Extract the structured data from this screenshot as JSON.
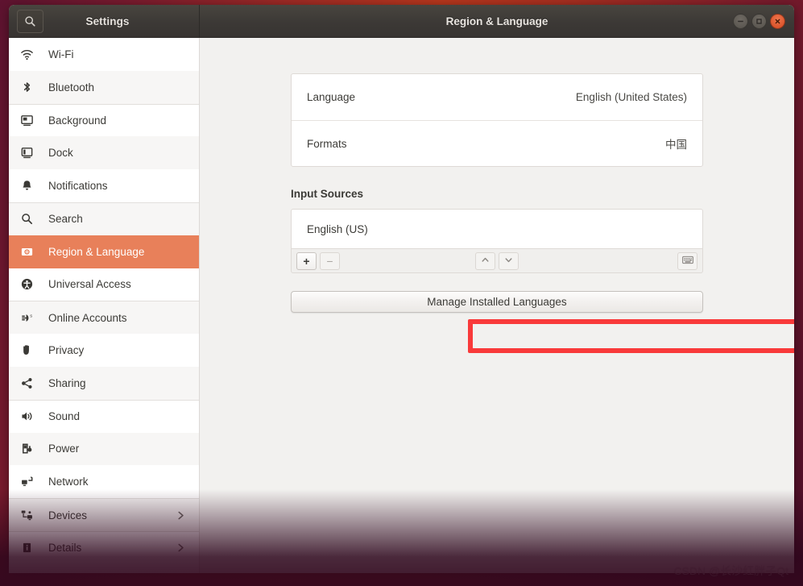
{
  "window": {
    "app_title": "Settings",
    "panel_title": "Region & Language",
    "search_icon": "search-icon",
    "controls": {
      "minimize": "minimize-icon",
      "maximize": "maximize-icon",
      "close": "close-icon"
    }
  },
  "colors": {
    "accent": "#E8805A",
    "ubuntu_orange": "#E95420",
    "titlebar": "#3C3936",
    "highlight_box": "#F93A3A",
    "content_bg": "#F2F1EF"
  },
  "sidebar": {
    "items": [
      {
        "label": "Wi-Fi",
        "icon": "wifi-icon",
        "active": false,
        "chevron": false,
        "group_start": true
      },
      {
        "label": "Bluetooth",
        "icon": "bluetooth-icon",
        "active": false,
        "chevron": false,
        "group_start": false
      },
      {
        "label": "Background",
        "icon": "background-icon",
        "active": false,
        "chevron": false,
        "group_start": true
      },
      {
        "label": "Dock",
        "icon": "dock-icon",
        "active": false,
        "chevron": false,
        "group_start": false
      },
      {
        "label": "Notifications",
        "icon": "bell-icon",
        "active": false,
        "chevron": false,
        "group_start": false
      },
      {
        "label": "Search",
        "icon": "search-icon",
        "active": false,
        "chevron": false,
        "group_start": true
      },
      {
        "label": "Region & Language",
        "icon": "region-language-icon",
        "active": true,
        "chevron": false,
        "group_start": false
      },
      {
        "label": "Universal Access",
        "icon": "universal-access-icon",
        "active": false,
        "chevron": false,
        "group_start": false
      },
      {
        "label": "Online Accounts",
        "icon": "online-accounts-icon",
        "active": false,
        "chevron": false,
        "group_start": true
      },
      {
        "label": "Privacy",
        "icon": "privacy-hand-icon",
        "active": false,
        "chevron": false,
        "group_start": false
      },
      {
        "label": "Sharing",
        "icon": "sharing-icon",
        "active": false,
        "chevron": false,
        "group_start": false
      },
      {
        "label": "Sound",
        "icon": "sound-icon",
        "active": false,
        "chevron": false,
        "group_start": true
      },
      {
        "label": "Power",
        "icon": "power-icon",
        "active": false,
        "chevron": false,
        "group_start": false
      },
      {
        "label": "Network",
        "icon": "network-icon",
        "active": false,
        "chevron": false,
        "group_start": false
      },
      {
        "label": "Devices",
        "icon": "devices-icon",
        "active": false,
        "chevron": true,
        "group_start": true
      },
      {
        "label": "Details",
        "icon": "details-info-icon",
        "active": false,
        "chevron": true,
        "group_start": true
      }
    ]
  },
  "main": {
    "rows": [
      {
        "label": "Language",
        "value": "English (United States)"
      },
      {
        "label": "Formats",
        "value": "中国"
      }
    ],
    "input_sources": {
      "title": "Input Sources",
      "entries": [
        "English (US)"
      ],
      "toolbar": {
        "add_label": "+",
        "remove_label": "−",
        "move_up": "chevron-up-icon",
        "move_down": "chevron-down-icon",
        "keyboard_shortcut": "keyboard-icon"
      }
    },
    "manage_button_label": "Manage Installed Languages"
  },
  "watermark": {
    "text": "CSDN @长沙红胖子Qt"
  }
}
